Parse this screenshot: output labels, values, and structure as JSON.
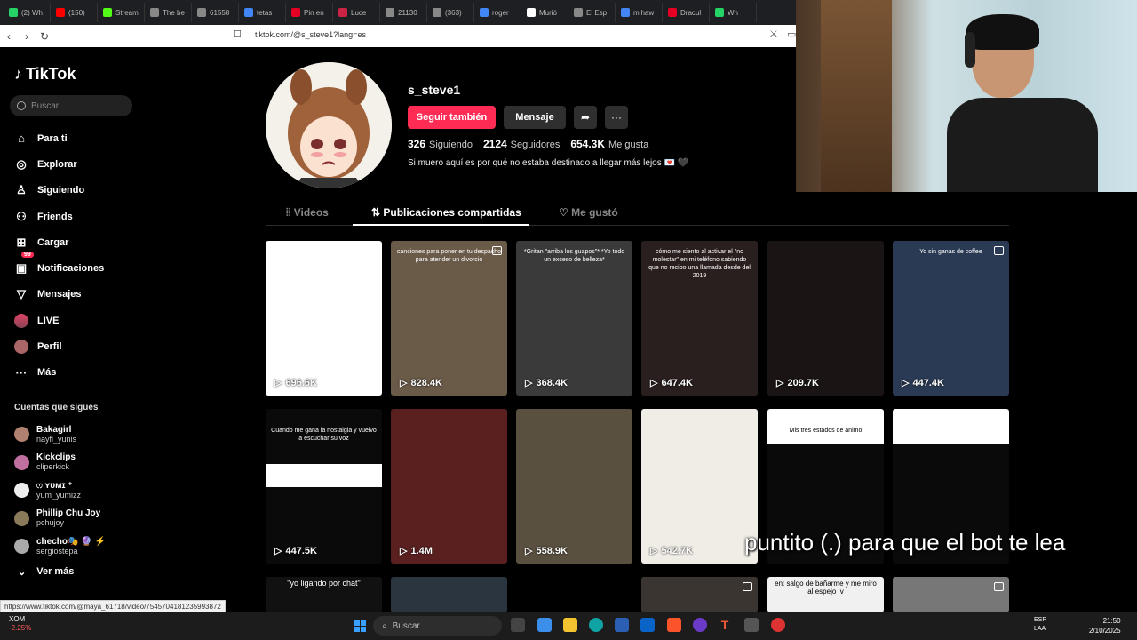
{
  "browser": {
    "tabs": [
      {
        "label": "(2) Wh",
        "color": "#25d366"
      },
      {
        "label": "(150)",
        "color": "#ff0000"
      },
      {
        "label": "Stream",
        "color": "#53fc18"
      },
      {
        "label": "The be",
        "color": "#888888"
      },
      {
        "label": "61558",
        "color": "#888888"
      },
      {
        "label": "tetas",
        "color": "#4285f4"
      },
      {
        "label": "Pin en",
        "color": "#e60023"
      },
      {
        "label": "Luce",
        "color": "#cc2244"
      },
      {
        "label": "21130",
        "color": "#888888"
      },
      {
        "label": "(363)",
        "color": "#888888"
      },
      {
        "label": "roger",
        "color": "#4285f4"
      },
      {
        "label": "Murió",
        "color": "#ffffff"
      },
      {
        "label": "El Esp",
        "color": "#888888"
      },
      {
        "label": "mihaw",
        "color": "#4285f4"
      },
      {
        "label": "Dracul",
        "color": "#e60023"
      },
      {
        "label": "Wh",
        "color": "#25d366"
      }
    ],
    "url": "tiktok.com/@s_steve1?lang=es",
    "status_url": "https://www.tiktok.com/@maya_61718/video/7545704181235993872"
  },
  "sidebar": {
    "logo": "TikTok",
    "search_placeholder": "Buscar",
    "nav": [
      {
        "label": "Para ti",
        "icon": "home-icon"
      },
      {
        "label": "Explorar",
        "icon": "compass-icon"
      },
      {
        "label": "Siguiendo",
        "icon": "following-icon"
      },
      {
        "label": "Friends",
        "icon": "friends-icon"
      },
      {
        "label": "Cargar",
        "icon": "upload-icon"
      },
      {
        "label": "Notificaciones",
        "icon": "inbox-icon",
        "badge": "99"
      },
      {
        "label": "Mensajes",
        "icon": "send-icon"
      },
      {
        "label": "LIVE",
        "icon": "live-icon"
      },
      {
        "label": "Perfil",
        "icon": "profile-icon"
      },
      {
        "label": "Más",
        "icon": "more-icon"
      }
    ],
    "following_title": "Cuentas que sigues",
    "following": [
      {
        "name": "Bakagirl",
        "user": "nayfi_yunis",
        "color": "#b08070"
      },
      {
        "name": "Kickclips",
        "user": "cliperkick",
        "color": "#c070a0"
      },
      {
        "name": "ෆ ʏᴜᴍɪ ⁺",
        "user": "yum_yumizz",
        "color": "#eeeeee"
      },
      {
        "name": "Phillip Chu Joy",
        "user": "pchujoy",
        "color": "#8a7a5a"
      },
      {
        "name": "checho🎭 🔮 ⚡",
        "user": "sergiostepa",
        "color": "#aaaaaa"
      }
    ],
    "see_more": "Ver más"
  },
  "profile": {
    "username": "s_steve1",
    "follow_button": "Seguir también",
    "message_button": "Mensaje",
    "following_count": "326",
    "following_label": "Siguiendo",
    "followers_count": "2124",
    "followers_label": "Seguidores",
    "likes_count": "654.3K",
    "likes_label": "Me gusta",
    "bio": "Si muero aquí es por qué no estaba destinado a llegar más lejos 💌 🖤"
  },
  "tabs": {
    "videos": "Videos",
    "reposts": "Publicaciones compartidas",
    "liked": "Me gustó"
  },
  "videos": [
    {
      "views": "696.6K",
      "caption": "",
      "bg": "#ffffff"
    },
    {
      "views": "828.4K",
      "caption": "canciones para poner en tu despacho para atender un divorcio",
      "bg": "#6a5a48"
    },
    {
      "views": "368.4K",
      "caption": "*Gritan \"arriba los guapos\"* *Yo todo un exceso de belleza*",
      "bg": "#3a3a3a"
    },
    {
      "views": "647.4K",
      "caption": "cómo me siento al activar el \"no molestar\" en mi teléfono sabiendo que no recibo una llamada desde del 2019",
      "bg": "#2a1f1f"
    },
    {
      "views": "209.7K",
      "caption": "",
      "bg": "#1a1414"
    },
    {
      "views": "447.4K",
      "caption": "Yo sin ganas de coffee",
      "bg": "#2a3a55"
    },
    {
      "views": "447.5K",
      "caption": "Cuando me gana la nostalgia y vuelvo a escuchar su voz",
      "bg": "#0a0a0a"
    },
    {
      "views": "1.4M",
      "caption": "",
      "bg": "#5a2020"
    },
    {
      "views": "558.9K",
      "caption": "",
      "bg": "#5a5040"
    },
    {
      "views": "542.7K",
      "caption": "",
      "bg": "#f0ece6"
    },
    {
      "views": "",
      "caption": "Mis tres estados de ánimo",
      "bg": "#0a0a0a"
    },
    {
      "views": "",
      "caption": "",
      "bg": "#0a0a0a"
    }
  ],
  "row3": [
    {
      "caption": "\"yo ligando por chat\""
    },
    {
      "caption": ""
    },
    {
      "caption": ""
    },
    {
      "caption": ""
    },
    {
      "caption": "en: salgo de bañarme y me miro al espejo :v"
    },
    {
      "caption": ""
    }
  ],
  "overlay_subtitle": "puntito (.) para que el bot te lea",
  "taskbar": {
    "ticker_name": "XOM",
    "ticker_change": "-2.25%",
    "search_placeholder": "Buscar",
    "lang_top": "ESP",
    "lang_bottom": "LAA",
    "time": "21:50",
    "date": "2/10/2025"
  }
}
